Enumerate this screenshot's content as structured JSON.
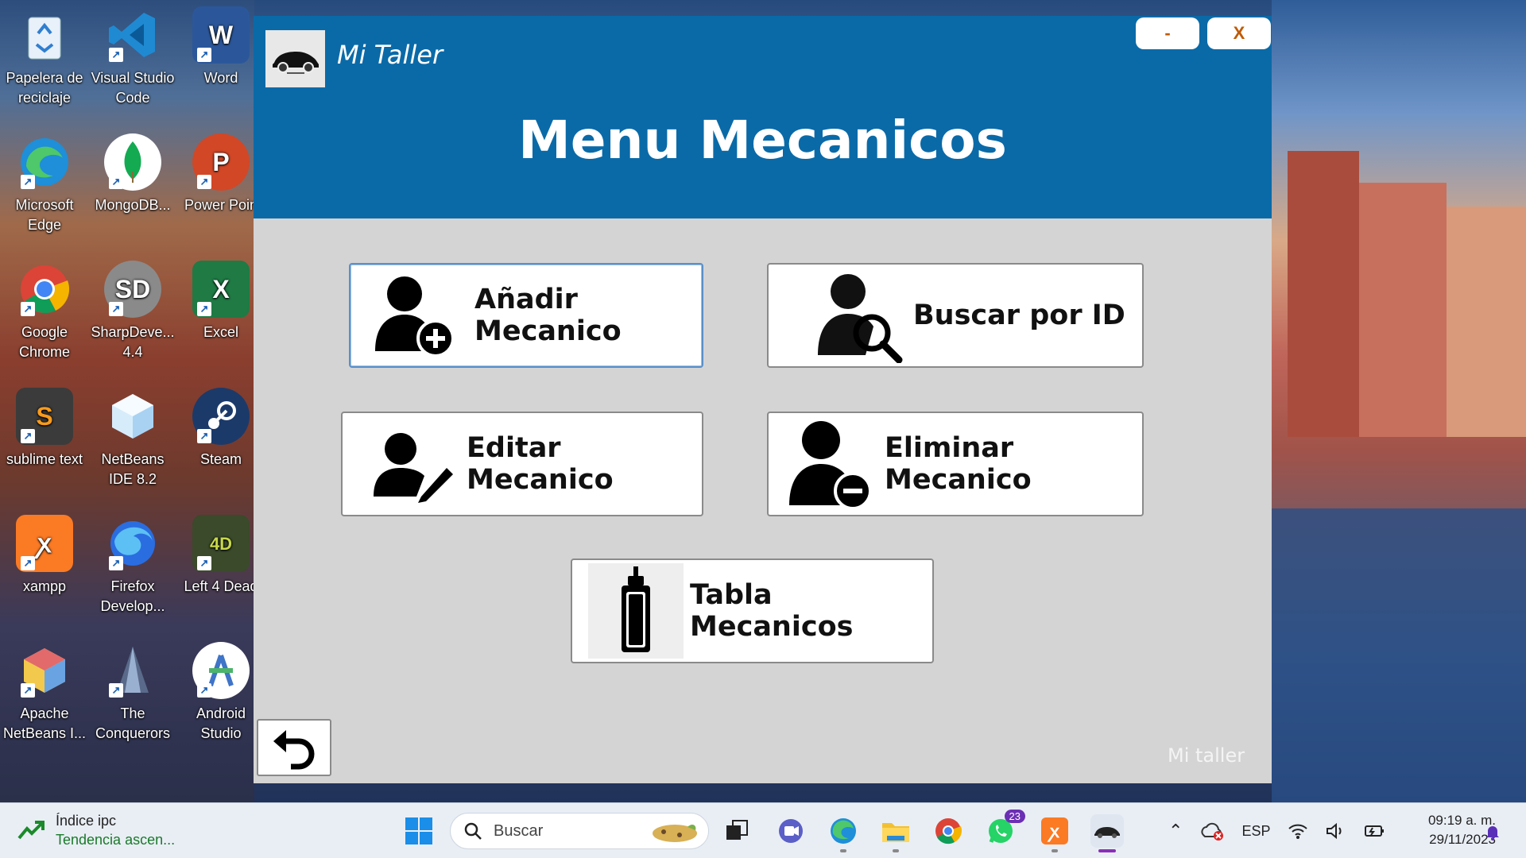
{
  "desktop": {
    "icons": [
      {
        "label": "Papelera de reciclaje",
        "icon": "recycle-bin-icon"
      },
      {
        "label": "Visual Studio Code",
        "icon": "vscode-icon"
      },
      {
        "label": "Word",
        "icon": "word-icon"
      },
      {
        "label": "Microsoft Edge",
        "icon": "edge-icon"
      },
      {
        "label": "MongoDB...",
        "icon": "mongodb-icon"
      },
      {
        "label": "Power Poin",
        "icon": "powerpoint-icon"
      },
      {
        "label": "Google Chrome",
        "icon": "chrome-icon"
      },
      {
        "label": "SharpDeve... 4.4",
        "icon": "sharpdevelop-icon"
      },
      {
        "label": "Excel",
        "icon": "excel-icon"
      },
      {
        "label": "sublime text",
        "icon": "sublime-icon"
      },
      {
        "label": "NetBeans IDE 8.2",
        "icon": "netbeans-icon"
      },
      {
        "label": "Steam",
        "icon": "steam-icon"
      },
      {
        "label": "xampp",
        "icon": "xampp-icon"
      },
      {
        "label": "Firefox Develop...",
        "icon": "firefox-icon"
      },
      {
        "label": "Left 4 Dead",
        "icon": "left4dead-icon"
      },
      {
        "label": "Apache NetBeans I...",
        "icon": "apache-netbeans-icon"
      },
      {
        "label": "The Conquerors",
        "icon": "conquerors-icon"
      },
      {
        "label": "Android Studio",
        "icon": "android-studio-icon"
      }
    ]
  },
  "app": {
    "title": "Mi Taller",
    "min_label": "-",
    "close_label": "X",
    "heading": "Menu Mecanicos",
    "buttons": {
      "add": "Añadir Mecanico",
      "search": "Buscar por ID",
      "edit": "Editar Mecanico",
      "delete": "Eliminar Mecanico",
      "table": "Tabla Mecanicos"
    },
    "footer": "Mi taller"
  },
  "taskbar": {
    "widget_title": "Índice ipc",
    "widget_sub": "Tendencia ascen...",
    "search_placeholder": "Buscar",
    "whatsapp_badge": "23",
    "lang": "ESP",
    "time": "09:19 a. m.",
    "date": "29/11/2023"
  },
  "colors": {
    "titlebar": "#0a6aa8",
    "content_bg": "#d4d4d4",
    "close_text": "#c05a00"
  }
}
